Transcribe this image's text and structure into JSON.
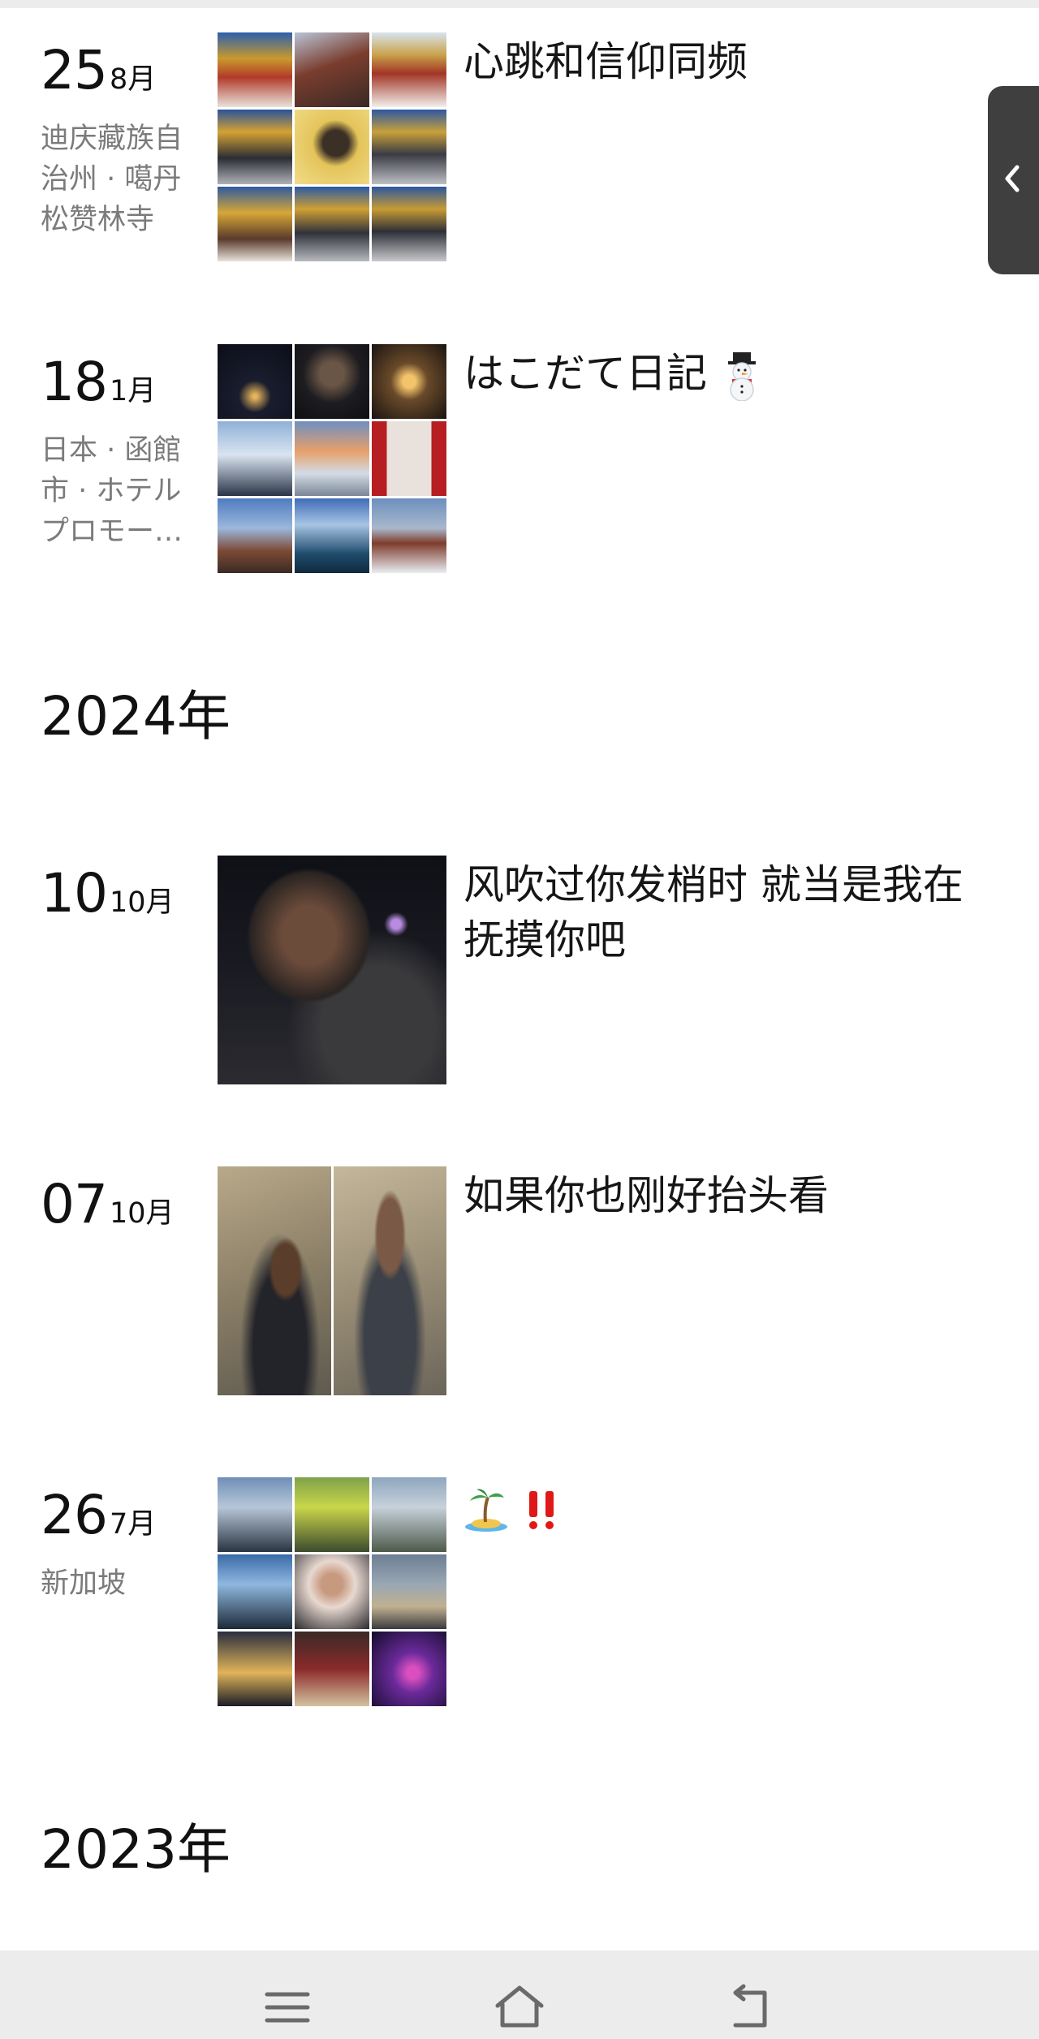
{
  "entries": [
    {
      "day": "25",
      "month": "8月",
      "location": "迪庆藏族自治州 · 噶丹松赞林寺",
      "caption": "心跳和信仰同频"
    },
    {
      "day": "18",
      "month": "1月",
      "location": "日本 · 函館市 · ホテルプロモー…",
      "caption": "はこだて日記"
    },
    {
      "day": "10",
      "month": "10月",
      "location": "",
      "caption": "风吹过你发梢时 就当是我在抚摸你吧"
    },
    {
      "day": "07",
      "month": "10月",
      "location": "",
      "caption": "如果你也刚好抬头看"
    },
    {
      "day": "26",
      "month": "7月",
      "location": "新加坡",
      "caption": ""
    }
  ],
  "years": {
    "y2024": "2024年",
    "y2023": "2023年"
  },
  "icons": {
    "snowman": "snowman-icon",
    "island": "desert-island-icon",
    "exclamation": "double-exclamation-icon",
    "side_tab": "chevron-left-icon",
    "nav": [
      "menu-icon",
      "home-icon",
      "back-icon"
    ]
  },
  "colors": {
    "location_text": "#7b7b7b",
    "nav_bar": "#ececec",
    "side_tab": "#3f3f3f",
    "exclamation": "#e01818"
  }
}
